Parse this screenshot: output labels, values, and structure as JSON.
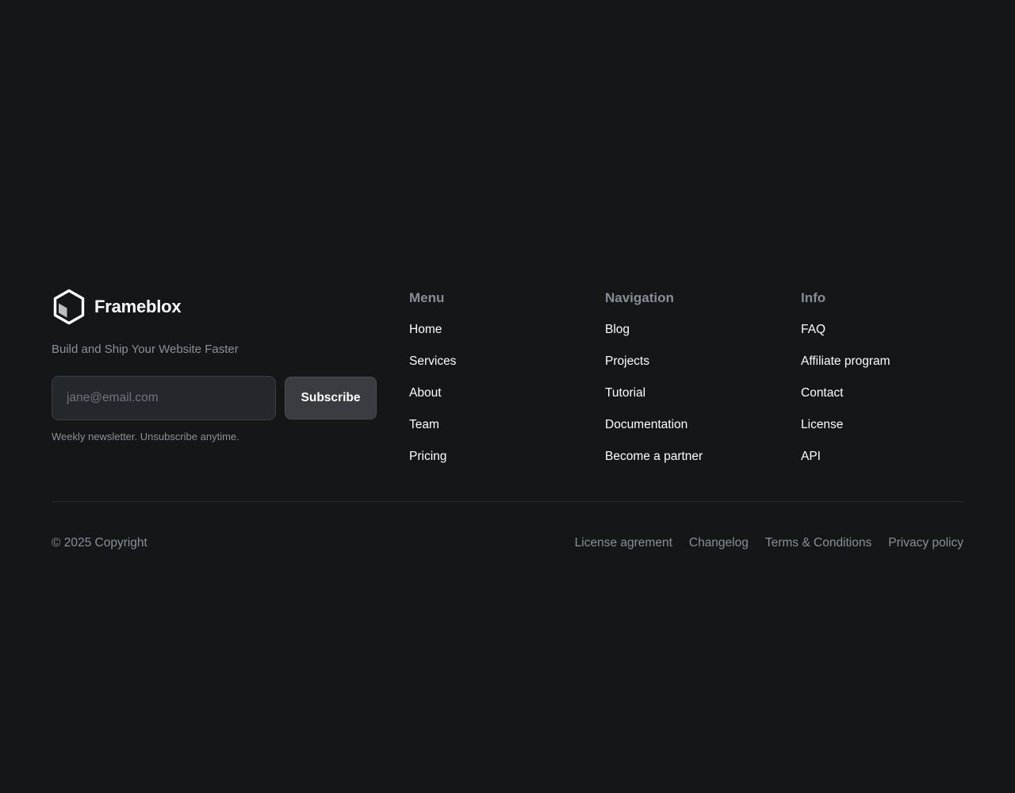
{
  "brand": {
    "name": "Frameblox",
    "tagline": "Build and Ship Your Website Faster"
  },
  "newsletter": {
    "placeholder": "jane@email.com",
    "value": "",
    "button_label": "Subscribe",
    "note": "Weekly newsletter. Unsubscribe anytime."
  },
  "columns": [
    {
      "title": "Menu",
      "items": [
        "Home",
        "Services",
        "About",
        "Team",
        "Pricing"
      ]
    },
    {
      "title": "Navigation",
      "items": [
        "Blog",
        "Projects",
        "Tutorial",
        "Documentation",
        "Become a partner"
      ]
    },
    {
      "title": "Info",
      "items": [
        "FAQ",
        "Affiliate program",
        "Contact",
        "License",
        "API"
      ]
    }
  ],
  "bottom": {
    "copyright": "© 2025 Copyright",
    "links": [
      "License agrement",
      "Changelog",
      "Terms & Conditions",
      "Privacy policy"
    ]
  },
  "colors": {
    "background": "#151618",
    "muted_text": "#8b8f99",
    "heading": "#888c95",
    "link": "#ffffff",
    "button_bg": "#3a3c42"
  }
}
